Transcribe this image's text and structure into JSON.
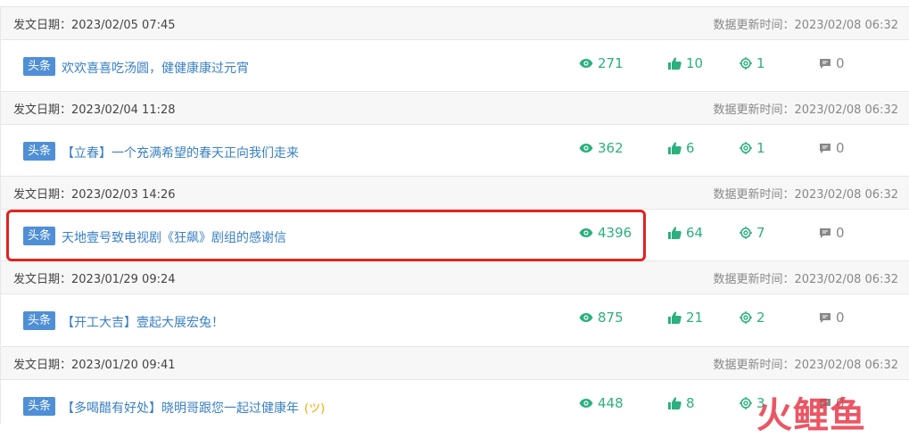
{
  "groups": [
    {
      "post_date": "发文日期：2023/02/05 07:45",
      "update_time": "数据更新时间：2023/02/08 06:32",
      "tag": "头条",
      "title": "欢欢喜喜吃汤圆，健健康康过元宵",
      "views": "271",
      "likes": "10",
      "shares": "1",
      "comments": "0"
    },
    {
      "post_date": "发文日期：2023/02/04 11:28",
      "update_time": "数据更新时间：2023/02/08 06:32",
      "tag": "头条",
      "title": "【立春】一个充满希望的春天正向我们走来",
      "views": "362",
      "likes": "6",
      "shares": "1",
      "comments": "0"
    },
    {
      "post_date": "发文日期：2023/02/03 14:26",
      "update_time": "数据更新时间：2023/02/08 06:32",
      "tag": "头条",
      "title": "天地壹号致电视剧《狂飙》剧组的感谢信",
      "views": "4396",
      "likes": "64",
      "shares": "7",
      "comments": "0"
    },
    {
      "post_date": "发文日期：2023/01/29 09:24",
      "update_time": "数据更新时间：2023/02/08 06:32",
      "tag": "头条",
      "title": "【开工大吉】壹起大展宏兔！",
      "views": "875",
      "likes": "21",
      "shares": "2",
      "comments": "0"
    },
    {
      "post_date": "发文日期：2023/01/20 09:41",
      "update_time": "数据更新时间：2023/02/08 06:32",
      "tag": "头条",
      "title": "【多喝醋有好处】晓明哥跟您一起过健康年",
      "views": "448",
      "likes": "8",
      "shares": "3",
      "comments": "0"
    }
  ],
  "watermark": "火鲤鱼",
  "colors": {
    "accent": "#2bb07e",
    "link": "#3a80c5",
    "tag": "#4f8fd6",
    "highlight": "#e0231f"
  }
}
